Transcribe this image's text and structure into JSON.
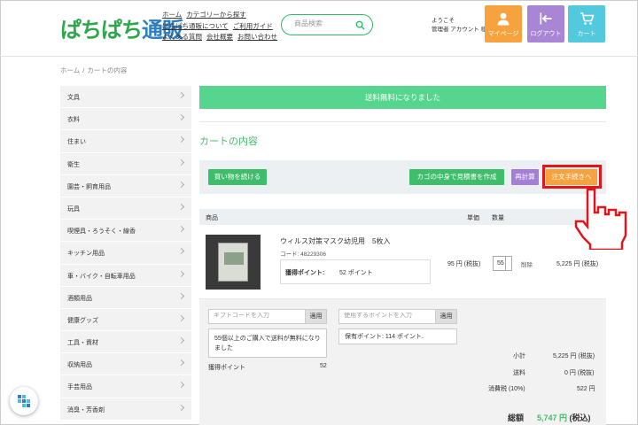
{
  "header": {
    "logo_text_a": "ぱちぱち",
    "logo_text_b": "通販",
    "links_row1": [
      "ホーム",
      "カテゴリーから探す"
    ],
    "links_row2": [
      "ぱちぱち通販について",
      "ご利用ガイド"
    ],
    "links_row3": [
      "よくある質問",
      "会社概要",
      "お問い合わせ"
    ],
    "search_placeholder": "商品検索",
    "welcome_line1": "ようこそ",
    "welcome_line2": "管理者 アカウント 様",
    "mypage_label": "マイページ",
    "logout_label": "ログアウト",
    "cart_label": "カート",
    "colors": {
      "mypage": "#f6a23f",
      "logout": "#a985d6",
      "cart": "#53c9dd",
      "accent_green": "#3fbf6a"
    }
  },
  "breadcrumb": {
    "home": "ホーム",
    "sep": "/",
    "current": "カートの内容"
  },
  "sidebar": {
    "items": [
      "文具",
      "衣料",
      "住まい",
      "衛生",
      "園芸・飼育用品",
      "玩具",
      "喫煙具・ろうそく・線香",
      "キッチン用品",
      "車・バイク・自転車用品",
      "酒類用品",
      "健康グッズ",
      "工具・資材",
      "収納用品",
      "手芸用品",
      "消臭・芳香剤"
    ]
  },
  "main": {
    "banner": "送料無料になりました",
    "title": "カートの内容",
    "buttons": {
      "continue": "買い物を続ける",
      "quote": "カゴの中身で見積書を作成",
      "recalc": "再計算",
      "order": "注文手続きへ"
    },
    "table_headers": {
      "product": "商品",
      "unit_price": "単価",
      "qty": "数量"
    },
    "item": {
      "name": "ウィルス対策マスク幼児用　5枚入",
      "code": "コード: 48229306",
      "points_label": "獲得ポイント:",
      "points_value": "52 ポイント",
      "unit_price": "95 円 (税抜)",
      "qty": "55",
      "delete": "削除",
      "subtotal": "5,225 円 (税抜)"
    },
    "gift": {
      "placeholder": "ギフトコードを入力",
      "apply": "適用"
    },
    "point_use": {
      "placeholder": "使用するポイントを入力",
      "apply": "適用"
    },
    "shipping_notice": "55個以上のご購入で送料が無料になりました",
    "held_points": "保有ポイント: 114 ポイント.",
    "earned_label": "獲得ポイント",
    "earned_value": "52",
    "summary": {
      "subtotal_label": "小計",
      "subtotal_value": "5,225 円 (税抜)",
      "shipping_label": "送料",
      "shipping_value": "0 円 (税抜)",
      "tax_label": "消費税 (10%)",
      "tax_value": "522 円",
      "total_label": "総額",
      "total_value": "5,747 円",
      "total_tax": "(税込)"
    }
  }
}
